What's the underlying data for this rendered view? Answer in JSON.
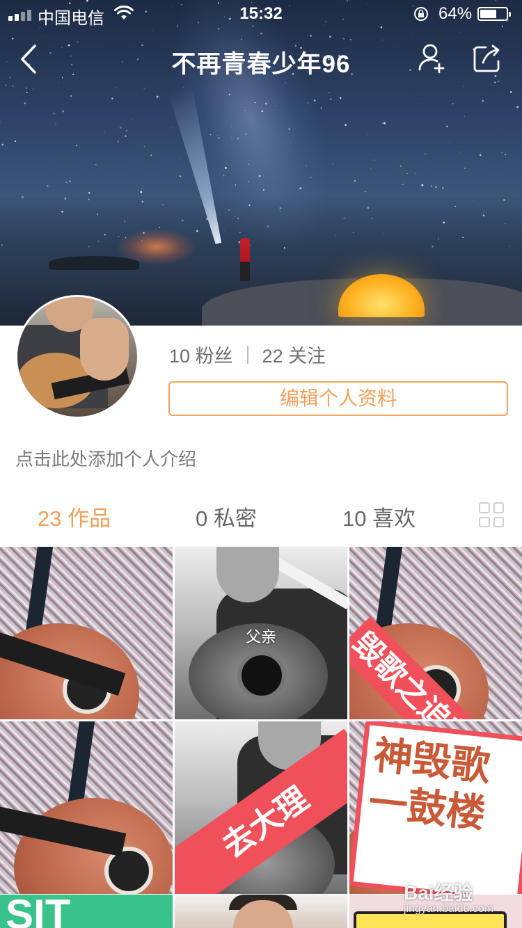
{
  "status_bar": {
    "carrier": "中国电信",
    "time": "15:32",
    "battery_percent": "64%",
    "battery_level": 0.64,
    "icons": [
      "signal-icon",
      "wifi-icon",
      "rotation-lock-icon",
      "battery-icon"
    ]
  },
  "nav": {
    "title": "不再青春少年96",
    "back_icon": "chevron-left-icon",
    "add_user_icon": "add-user-icon",
    "share_icon": "share-icon"
  },
  "profile": {
    "fans": "10 粉丝",
    "following": "22 关注",
    "edit_label": "编辑个人资料",
    "intro_placeholder": "点击此处添加个人介绍"
  },
  "tabs": [
    {
      "label": "23 作品",
      "active": true
    },
    {
      "label": "0 私密",
      "active": false
    },
    {
      "label": "10 喜欢",
      "active": false
    }
  ],
  "grid_toggle_icon": "grid-view-icon",
  "videos": [
    {
      "caption": ""
    },
    {
      "caption": "父亲"
    },
    {
      "caption": "毁歌之追梦赤子心"
    },
    {
      "caption": ""
    },
    {
      "caption": "去大理"
    },
    {
      "caption_line1": "神毁歌",
      "caption_line2": "一鼓楼"
    }
  ],
  "watermark": {
    "text": "Bai经验",
    "sub": "jingyan.baidu.com"
  },
  "colors": {
    "accent": "#f3a05a",
    "banner_red": "#f0505a"
  }
}
